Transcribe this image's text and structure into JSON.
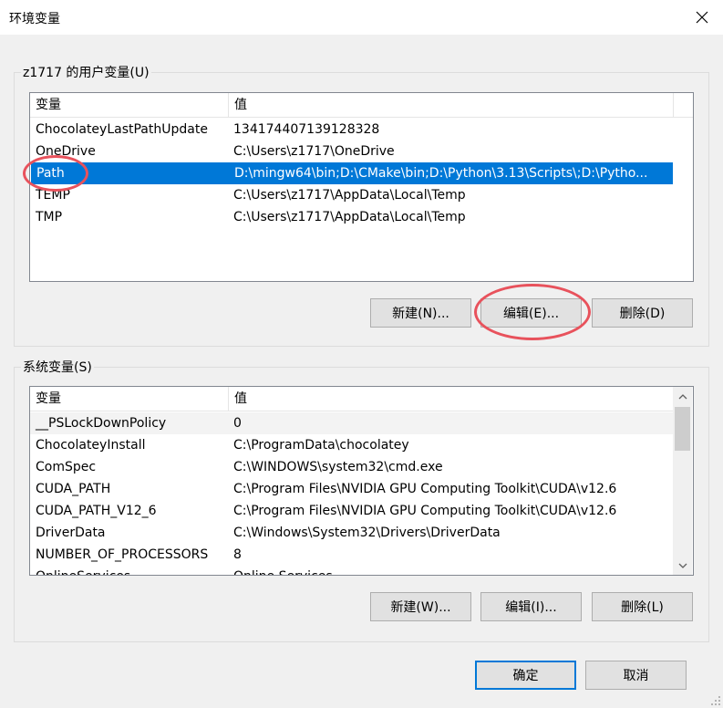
{
  "window": {
    "title": "环境变量"
  },
  "icons": {
    "close": "close-icon",
    "scroll_up": "chevron-up-icon",
    "scroll_down": "chevron-down-icon"
  },
  "user_vars": {
    "group_label": "z1717 的用户变量(U)",
    "columns": {
      "name": "变量",
      "value": "值"
    },
    "rows": [
      {
        "name": "ChocolateyLastPathUpdate",
        "value": "134174407139128328"
      },
      {
        "name": "OneDrive",
        "value": "C:\\Users\\z1717\\OneDrive"
      },
      {
        "name": "Path",
        "value": "D:\\mingw64\\bin;D:\\CMake\\bin;D:\\Python\\3.13\\Scripts\\;D:\\Pytho..."
      },
      {
        "name": "TEMP",
        "value": "C:\\Users\\z1717\\AppData\\Local\\Temp"
      },
      {
        "name": "TMP",
        "value": "C:\\Users\\z1717\\AppData\\Local\\Temp"
      }
    ],
    "selected_row": "Path",
    "buttons": {
      "new": "新建(N)...",
      "edit": "编辑(E)...",
      "delete": "删除(D)"
    }
  },
  "system_vars": {
    "group_label": "系统变量(S)",
    "columns": {
      "name": "变量",
      "value": "值"
    },
    "rows": [
      {
        "name": "__PSLockDownPolicy",
        "value": "0"
      },
      {
        "name": "ChocolateyInstall",
        "value": "C:\\ProgramData\\chocolatey"
      },
      {
        "name": "ComSpec",
        "value": "C:\\WINDOWS\\system32\\cmd.exe"
      },
      {
        "name": "CUDA_PATH",
        "value": "C:\\Program Files\\NVIDIA GPU Computing Toolkit\\CUDA\\v12.6"
      },
      {
        "name": "CUDA_PATH_V12_6",
        "value": "C:\\Program Files\\NVIDIA GPU Computing Toolkit\\CUDA\\v12.6"
      },
      {
        "name": "DriverData",
        "value": "C:\\Windows\\System32\\Drivers\\DriverData"
      },
      {
        "name": "NUMBER_OF_PROCESSORS",
        "value": "8"
      },
      {
        "name": "OnlineServices",
        "value": "Online Services"
      }
    ],
    "buttons": {
      "new": "新建(W)...",
      "edit": "编辑(I)...",
      "delete": "删除(L)"
    }
  },
  "footer": {
    "ok": "确定",
    "cancel": "取消"
  },
  "colors": {
    "selection": "#0078d7",
    "annotation": "#e8525c",
    "background": "#f0f0f0"
  }
}
